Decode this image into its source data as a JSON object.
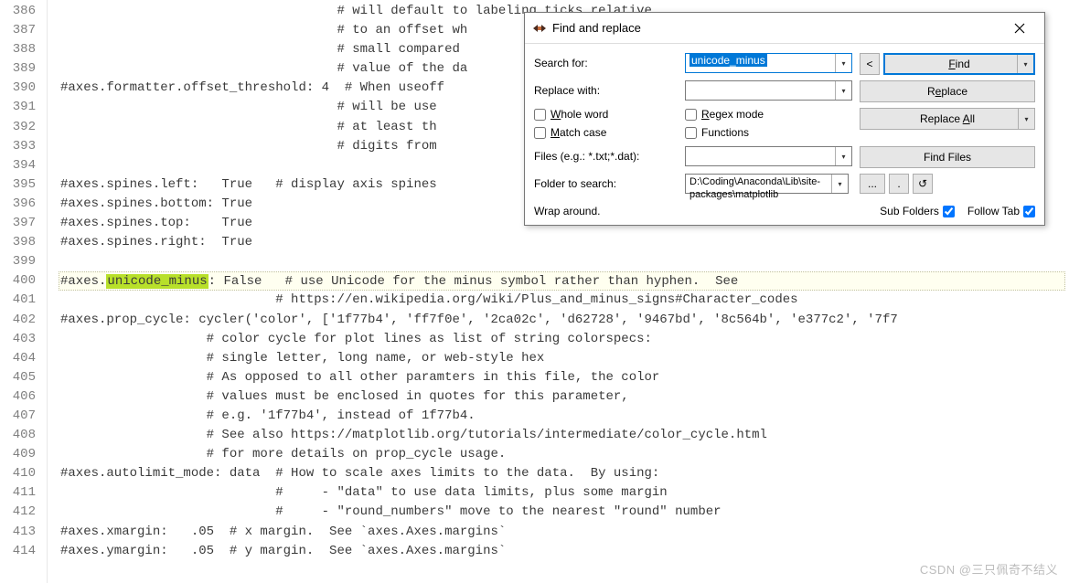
{
  "gutter": {
    "start": 386,
    "end": 414
  },
  "code": {
    "l386": "                                    # will default to labeling ticks relative",
    "l387": "                                    # to an offset wh",
    "l388": "                                    # small compared",
    "l389": "                                    # value of the da",
    "l390": "#axes.formatter.offset_threshold: 4  # When useoff",
    "l391": "                                    # will be use",
    "l392": "                                    # at least th",
    "l393": "                                    # digits from",
    "l394": "",
    "l395": "#axes.spines.left:   True   # display axis spines",
    "l396": "#axes.spines.bottom: True",
    "l397": "#axes.spines.top:    True",
    "l398": "#axes.spines.right:  True",
    "l399": "",
    "l400a": "#axes.",
    "l400b": "unicode_minus",
    "l400c": ": False   # use Unicode for the minus symbol rather than hyphen.  See",
    "l401": "                            # https://en.wikipedia.org/wiki/Plus_and_minus_signs#Character_codes",
    "l402": "#axes.prop_cycle: cycler('color', ['1f77b4', 'ff7f0e', '2ca02c', 'd62728', '9467bd', '8c564b', 'e377c2', '7f7",
    "l403": "                   # color cycle for plot lines as list of string colorspecs:",
    "l404": "                   # single letter, long name, or web-style hex",
    "l405": "                   # As opposed to all other paramters in this file, the color",
    "l406": "                   # values must be enclosed in quotes for this parameter,",
    "l407": "                   # e.g. '1f77b4', instead of 1f77b4.",
    "l408": "                   # See also https://matplotlib.org/tutorials/intermediate/color_cycle.html",
    "l409": "                   # for more details on prop_cycle usage.",
    "l410": "#axes.autolimit_mode: data  # How to scale axes limits to the data.  By using:",
    "l411": "                            #     - \"data\" to use data limits, plus some margin",
    "l412": "                            #     - \"round_numbers\" move to the nearest \"round\" number",
    "l413": "#axes.xmargin:   .05  # x margin.  See `axes.Axes.margins`",
    "l414": "#axes.ymargin:   .05  # y margin.  See `axes.Axes.margins`"
  },
  "dialog": {
    "title": "Find and replace",
    "search_label": "Search for:",
    "search_value": "unicode_minus",
    "replace_label": "Replace with:",
    "replace_value": "",
    "whole_word": "Whole word",
    "match_case": "Match case",
    "regex_mode": "Regex mode",
    "functions": "Functions",
    "files_label": "Files (e.g.: *.txt;*.dat):",
    "files_value": "",
    "folder_label": "Folder to search:",
    "folder_value": "D:\\Coding\\Anaconda\\Lib\\site-packages\\matplotlib",
    "prev_btn": "<",
    "find_btn": "Find",
    "replace_btn": "Replace",
    "replace_all_btn": "Replace All",
    "find_files_btn": "Find Files",
    "browse_btn": "...",
    "up_btn": ".",
    "cwd_btn": "↺",
    "status": "Wrap around.",
    "sub_folders": "Sub Folders",
    "follow_tab": "Follow Tab"
  },
  "watermark": "CSDN @三只佩奇不结义"
}
